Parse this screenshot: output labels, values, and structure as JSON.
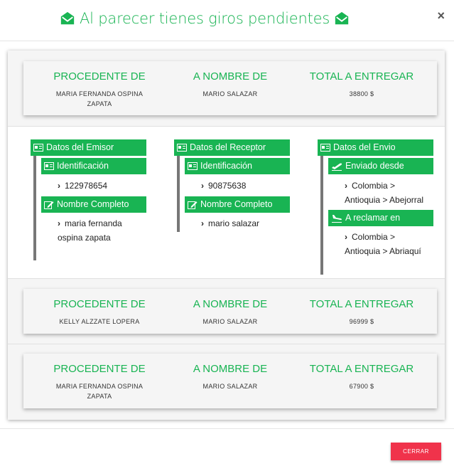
{
  "modal": {
    "title": "Al parecer tienes giros pendientes",
    "close_label": "×",
    "close_button": "CERRAR"
  },
  "labels": {
    "procedente": "PROCEDENTE DE",
    "nombre": "A NOMBRE DE",
    "total": "TOTAL A ENTREGAR"
  },
  "giros": [
    {
      "procedente": "MARIA FERNANDA OSPINA ZAPATA",
      "nombre": "MARIO SALAZAR",
      "total": "38800 $"
    },
    {
      "procedente": "KELLY ALZZATE LOPERA",
      "nombre": "MARIO SALAZAR",
      "total": "96999 $"
    },
    {
      "procedente": "MARIA FERNANDA OSPINA ZAPATA",
      "nombre": "MARIO SALAZAR",
      "total": "67900 $"
    }
  ],
  "detail": {
    "emisor": {
      "header": "Datos del Emisor",
      "id_label": "Identificación",
      "id_value": "122978654",
      "name_label": "Nombre Completo",
      "name_value_line1": "maria fernanda",
      "name_value_line2": "ospina zapata"
    },
    "receptor": {
      "header": "Datos del Receptor",
      "id_label": "Identificación",
      "id_value": "90875638",
      "name_label": "Nombre Completo",
      "name_value": "mario salazar"
    },
    "envio": {
      "header": "Datos del Envio",
      "sent_label": "Enviado desde",
      "sent_line1": "Colombia >",
      "sent_line2": "Antioquia > Abejorral",
      "claim_label": "A reclamar en",
      "claim_line1": "Colombia >",
      "claim_line2": "Antioquia > Abriaquí"
    }
  },
  "colors": {
    "accent": "#19b453",
    "danger": "#f0334b"
  },
  "icons": [
    "envelope-open-icon",
    "id-card-icon",
    "edit-icon",
    "plane-departure-icon",
    "plane-arrival-icon",
    "chevron-right-icon"
  ]
}
